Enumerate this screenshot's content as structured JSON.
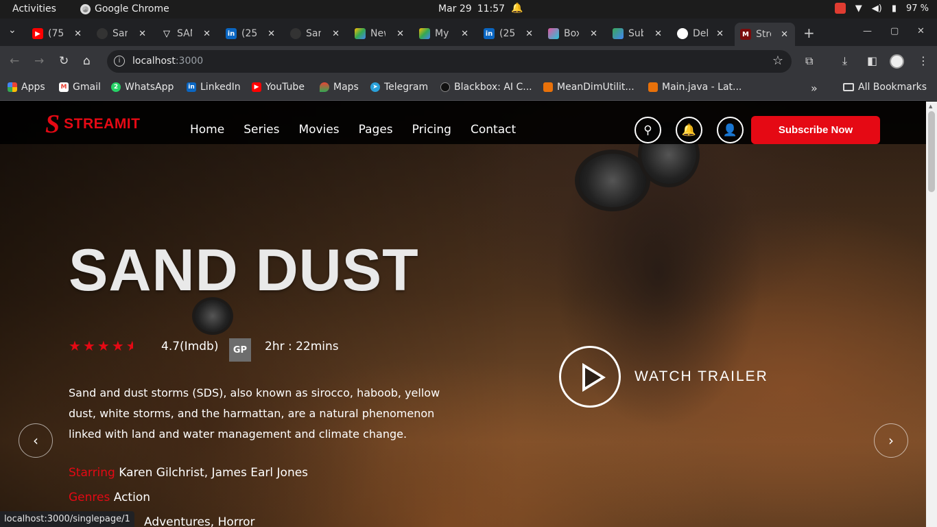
{
  "os_bar": {
    "activities": "Activities",
    "app_name": "Google Chrome",
    "date": "Mar 29",
    "time": "11:57",
    "battery": "97 %"
  },
  "tabs": [
    {
      "title": "(75",
      "icon": "youtube-icon",
      "color": "#ff0000"
    },
    {
      "title": "San",
      "icon": "github-icon",
      "color": "#444444"
    },
    {
      "title": "SAN",
      "icon": "vercel-icon",
      "color": "#ffffff"
    },
    {
      "title": "(25",
      "icon": "linkedin-icon",
      "color": "#0a66c2"
    },
    {
      "title": "San",
      "icon": "github-icon",
      "color": "#444444"
    },
    {
      "title": "New",
      "icon": "drive-icon",
      "color": "#fbbc04"
    },
    {
      "title": "My",
      "icon": "drive-icon",
      "color": "#34a853"
    },
    {
      "title": "(25",
      "icon": "linkedin-icon",
      "color": "#0a66c2"
    },
    {
      "title": "Box",
      "icon": "box-icon",
      "color": "#e056a0"
    },
    {
      "title": "Sub",
      "icon": "sub-icon",
      "color": "#3aa757"
    },
    {
      "title": "Del",
      "icon": "github-icon",
      "color": "#ffffff"
    },
    {
      "title": "Stre",
      "icon": "streamit-tab-icon",
      "color": "#7a0b0b"
    }
  ],
  "address_bar": {
    "host": "localhost",
    "port": ":3000"
  },
  "bookmarks": [
    {
      "label": "Apps",
      "icon": "apps-grid-icon",
      "color": "#e8710a"
    },
    {
      "label": "Gmail",
      "icon": "gmail-icon",
      "color": "#ea4335"
    },
    {
      "label": "WhatsApp",
      "icon": "whatsapp-icon",
      "color": "#25d366"
    },
    {
      "label": "LinkedIn",
      "icon": "linkedin-icon",
      "color": "#0a66c2"
    },
    {
      "label": "YouTube",
      "icon": "youtube-icon",
      "color": "#ff0000"
    },
    {
      "label": "Maps",
      "icon": "maps-icon",
      "color": "#34a853"
    },
    {
      "label": "Telegram",
      "icon": "telegram-icon",
      "color": "#2aa1da"
    },
    {
      "label": "Blackbox: AI C...",
      "icon": "blackbox-icon",
      "color": "#111111"
    },
    {
      "label": "MeanDimUtilit...",
      "icon": "tasks-icon",
      "color": "#e8710a"
    },
    {
      "label": "Main.java - Lat...",
      "icon": "tasks-icon",
      "color": "#e8710a"
    }
  ],
  "all_bookmarks": "All Bookmarks",
  "site": {
    "logo_letter": "S",
    "logo_text": "STREAMIT",
    "nav": [
      "Home",
      "Series",
      "Movies",
      "Pages",
      "Pricing",
      "Contact"
    ],
    "subscribe": "Subscribe Now",
    "accent": "#e50914"
  },
  "hero": {
    "title": "SAND DUST",
    "rating_stars": 4.5,
    "rating": "4.7(Imdb)",
    "badge": "GP",
    "duration": "2hr : 22mins",
    "description": "Sand and dust storms (SDS), also known as sirocco, haboob, yellow dust, white storms, and the harmattan, are a natural phenomenon linked with land and water management and climate change.",
    "starring_label": "Starring",
    "starring": "Karen Gilchrist, James Earl Jones",
    "genres_label": "Genres",
    "genres": "Action",
    "tag_partial": "Adventures, Horror",
    "watch_trailer": "WATCH TRAILER"
  },
  "status_url": "localhost:3000/singlepage/1"
}
